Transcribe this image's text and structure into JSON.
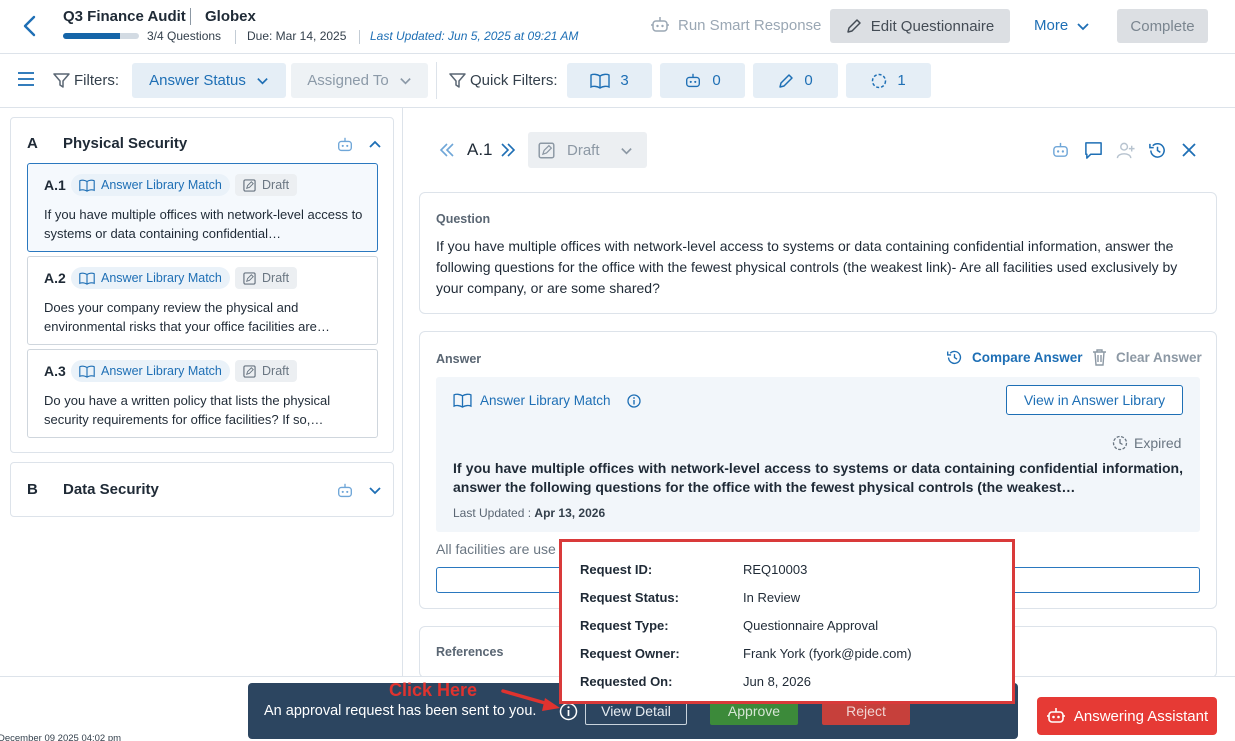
{
  "header": {
    "title": "Q3 Finance Audit",
    "company": "Globex",
    "progress_text": "3/4 Questions",
    "progress_fraction": 0.75,
    "due": "Due: Mar 14, 2025",
    "last_updated": "Last Updated: Jun 5, 2025 at 09:21 AM",
    "run_smart_response": "Run Smart Response",
    "edit_questionnaire": "Edit Questionnaire",
    "more": "More",
    "complete": "Complete"
  },
  "filters": {
    "label": "Filters:",
    "answer_status": "Answer Status",
    "assigned_to": "Assigned To",
    "quick_label": "Quick Filters:",
    "quick": [
      "3",
      "0",
      "0",
      "1"
    ]
  },
  "sections": [
    {
      "letter": "A",
      "name": "Physical Security",
      "questions": [
        {
          "id": "A.1",
          "tag": "Answer Library Match",
          "status": "Draft",
          "text": "If you have multiple offices with network-level access to systems or data containing confidential…"
        },
        {
          "id": "A.2",
          "tag": "Answer Library Match",
          "status": "Draft",
          "text": "Does your company review the physical and environmental risks that your office facilities are…"
        },
        {
          "id": "A.3",
          "tag": "Answer Library Match",
          "status": "Draft",
          "text": "Do you have a written policy that lists the physical security requirements for office facilities? If so,…"
        }
      ]
    },
    {
      "letter": "B",
      "name": "Data Security"
    }
  ],
  "detail": {
    "id": "A.1",
    "status": "Draft",
    "question_label": "Question",
    "question_text": "If you have multiple offices with network-level access to systems or data containing confidential information, answer the following questions for the office with the fewest physical controls (the weakest link)- Are all facilities used exclusively by your company, or are some shared?",
    "answer_label": "Answer",
    "compare_answer": "Compare Answer",
    "clear_answer": "Clear Answer",
    "library_match": "Answer Library Match",
    "view_in_library": "View in Answer Library",
    "expired": "Expired",
    "library_text": "If you have multiple offices with network-level access to systems or data containing confidential information, answer the following questions for the office with the fewest physical controls (the weakest…",
    "last_updated_label": "Last Updated :",
    "last_updated_value": "Apr 13, 2026",
    "answer_partial": "All facilities are use",
    "references_label": "References"
  },
  "popup": {
    "rows": [
      {
        "k": "Request ID:",
        "v": "REQ10003"
      },
      {
        "k": "Request Status:",
        "v": "In Review"
      },
      {
        "k": "Request Type:",
        "v": "Questionnaire Approval"
      },
      {
        "k": "Request Owner:",
        "v": "Frank York (fyork@pide.com)"
      },
      {
        "k": "Requested On:",
        "v": "Jun 8, 2026"
      }
    ]
  },
  "approval": {
    "message": "An approval request has been sent to you.",
    "view_detail": "View Detail",
    "approve": "Approve",
    "reject": "Reject"
  },
  "annotation": {
    "click_here": "Click Here"
  },
  "answering_assistant": "Answering Assistant",
  "footer_stamp": "December 09 2025 04:02 pm",
  "colors": {
    "accent": "#1e6fb5",
    "annotation_red": "#d93a3a",
    "approve_green": "#3c8a3a",
    "reject_red": "#c6403b"
  }
}
